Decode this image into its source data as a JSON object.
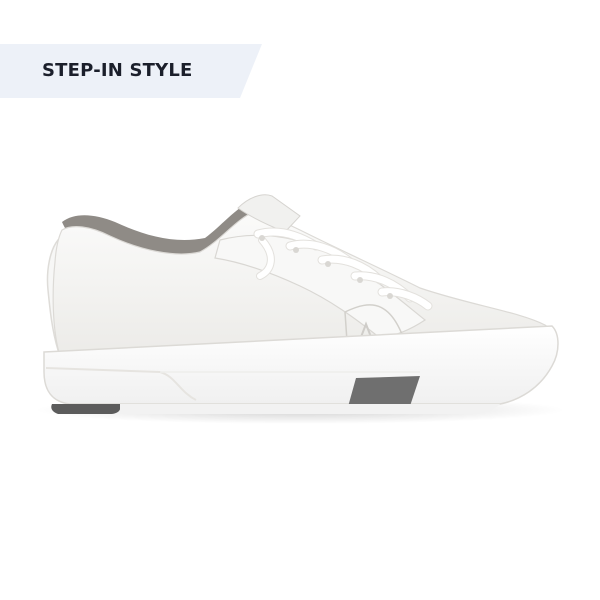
{
  "banner": {
    "label": "STEP-IN STYLE",
    "background_color": "#edf1f8",
    "text_color": "#1b1f2b"
  },
  "product": {
    "icons": [
      "sneaker-image",
      "brand-logo-icon"
    ],
    "colors": {
      "upper": "#f3f3f1",
      "collar_lining": "#8f8b86",
      "sole": "#ffffff",
      "heel_tab": "#6f6f6f",
      "outsole": "#5c5c5c"
    }
  }
}
